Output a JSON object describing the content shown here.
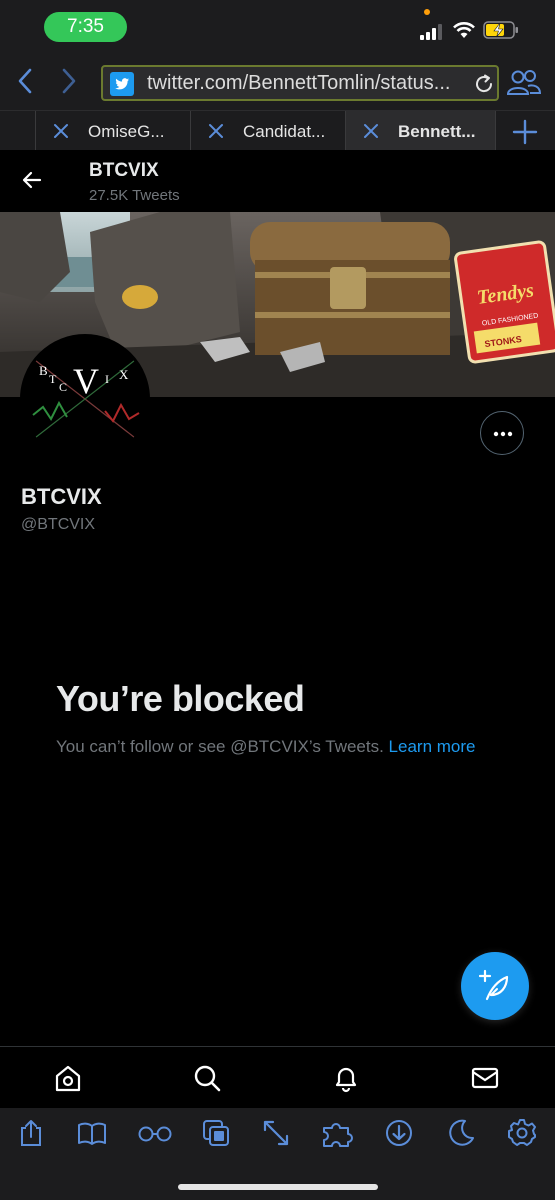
{
  "status_bar": {
    "time": "7:35"
  },
  "browser": {
    "url": "twitter.com/BennettTomlin/status...",
    "tabs": [
      {
        "label": ""
      },
      {
        "label": "OmiseG..."
      },
      {
        "label": "Candidat..."
      },
      {
        "label": "Bennett..."
      }
    ]
  },
  "profile_header": {
    "name": "BTCVIX",
    "tweet_count": "27.5K Tweets"
  },
  "banner": {
    "sign_brand": "Tendys",
    "sign_sub": "OLD FASHIONED",
    "sign_bottom": "STONKS"
  },
  "avatar": {
    "letters": [
      "B",
      "T",
      "C",
      "V",
      "I",
      "X"
    ]
  },
  "profile": {
    "display_name": "BTCVIX",
    "handle": "@BTCVIX"
  },
  "blocked": {
    "title": "You’re blocked",
    "message": "You can’t follow or see @BTCVIX’s Tweets. ",
    "link_text": "Learn more"
  },
  "colors": {
    "accent": "#1d9bf0",
    "background": "#000000",
    "time_pill": "#34c759",
    "browser_chrome": "#1c1c1e"
  },
  "icons": {
    "twitter_nav": [
      "home-icon",
      "search-icon",
      "notifications-icon",
      "messages-icon"
    ],
    "browser_tools": [
      "share-icon",
      "bookmarks-icon",
      "reading-list-icon",
      "tab-switcher-icon",
      "fullscreen-icon",
      "extensions-icon",
      "downloads-icon",
      "dark-mode-icon",
      "settings-icon"
    ]
  }
}
